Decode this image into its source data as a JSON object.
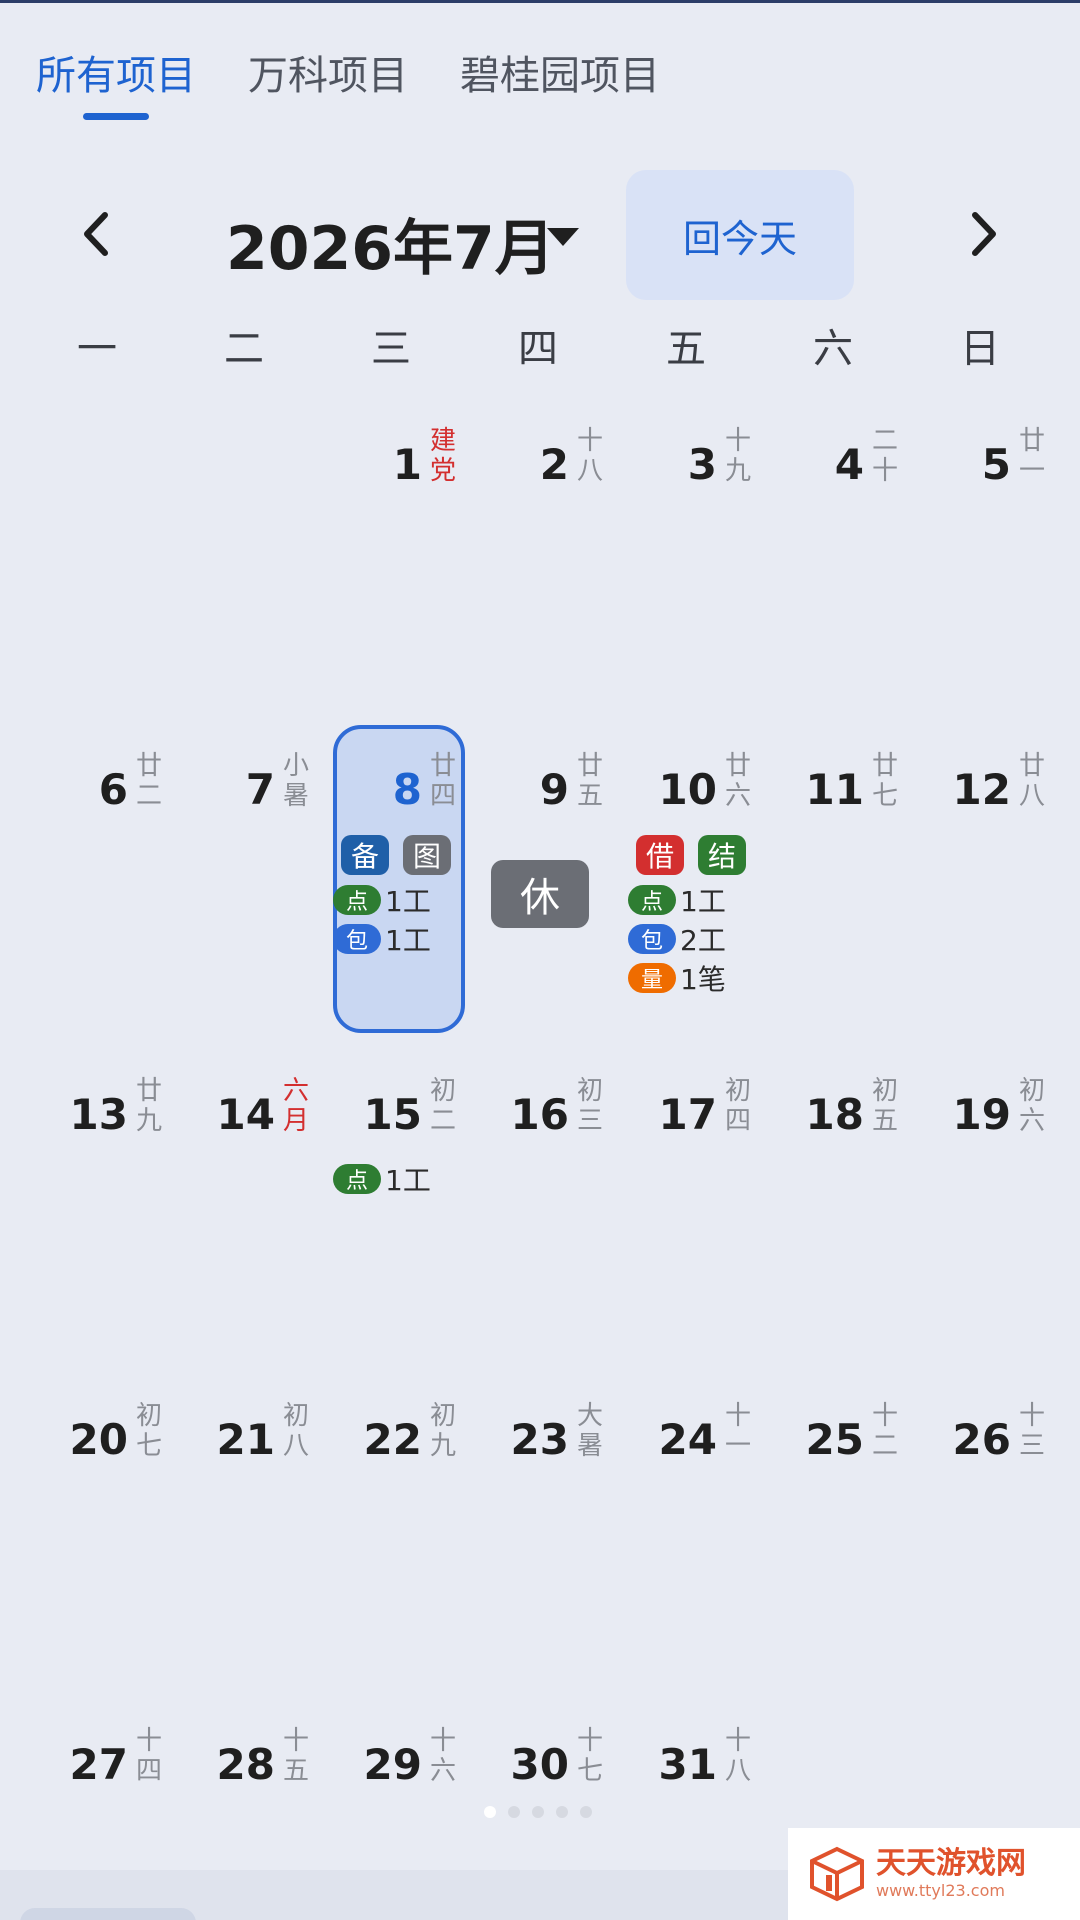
{
  "tabs": [
    {
      "label": "所有项目",
      "active": true
    },
    {
      "label": "万科项目",
      "active": false
    },
    {
      "label": "碧桂园项目",
      "active": false
    }
  ],
  "header": {
    "month_title": "2026年7月",
    "today_button": "回今天"
  },
  "weekdays": [
    "一",
    "二",
    "三",
    "四",
    "五",
    "六",
    "日"
  ],
  "colors": {
    "accent": "#1e63d0",
    "green": "#2e7d32",
    "blue": "#2f6bd6",
    "red": "#d32f2f",
    "orange": "#ef6c00",
    "gray": "#6b6e75",
    "navy": "#1f5fa8"
  },
  "days": [
    {
      "day": "1",
      "lunar": "建党",
      "lunar_red": true
    },
    {
      "day": "2",
      "lunar": "十八"
    },
    {
      "day": "3",
      "lunar": "十九"
    },
    {
      "day": "4",
      "lunar": "二十"
    },
    {
      "day": "5",
      "lunar": "廿一"
    },
    {
      "day": "6",
      "lunar": "廿二"
    },
    {
      "day": "7",
      "lunar": "小暑"
    },
    {
      "day": "8",
      "lunar": "廿四",
      "selected": true,
      "chips": [
        {
          "label": "备",
          "color": "navy"
        },
        {
          "label": "图",
          "color": "gray"
        }
      ],
      "items": [
        {
          "tag": "点",
          "color": "green",
          "text": "1工"
        },
        {
          "tag": "包",
          "color": "blue",
          "text": "1工"
        }
      ]
    },
    {
      "day": "9",
      "lunar": "廿五",
      "rest": "休"
    },
    {
      "day": "10",
      "lunar": "廿六",
      "chips": [
        {
          "label": "借",
          "color": "red"
        },
        {
          "label": "结",
          "color": "green"
        }
      ],
      "items": [
        {
          "tag": "点",
          "color": "green",
          "text": "1工"
        },
        {
          "tag": "包",
          "color": "blue",
          "text": "2工"
        },
        {
          "tag": "量",
          "color": "orange",
          "text": "1笔"
        }
      ]
    },
    {
      "day": "11",
      "lunar": "廿七"
    },
    {
      "day": "12",
      "lunar": "廿八"
    },
    {
      "day": "13",
      "lunar": "廿九"
    },
    {
      "day": "14",
      "lunar": "六月",
      "lunar_red": true
    },
    {
      "day": "15",
      "lunar": "初二",
      "items": [
        {
          "tag": "点",
          "color": "green",
          "text": "1工"
        }
      ]
    },
    {
      "day": "16",
      "lunar": "初三"
    },
    {
      "day": "17",
      "lunar": "初四"
    },
    {
      "day": "18",
      "lunar": "初五"
    },
    {
      "day": "19",
      "lunar": "初六"
    },
    {
      "day": "20",
      "lunar": "初七"
    },
    {
      "day": "21",
      "lunar": "初八"
    },
    {
      "day": "22",
      "lunar": "初九"
    },
    {
      "day": "23",
      "lunar": "大暑"
    },
    {
      "day": "24",
      "lunar": "十一"
    },
    {
      "day": "25",
      "lunar": "十二"
    },
    {
      "day": "26",
      "lunar": "十三"
    },
    {
      "day": "27",
      "lunar": "十四"
    },
    {
      "day": "28",
      "lunar": "十五"
    },
    {
      "day": "29",
      "lunar": "十六"
    },
    {
      "day": "30",
      "lunar": "十七"
    },
    {
      "day": "31",
      "lunar": "十八"
    }
  ],
  "first_weekday_index": 2,
  "page_dots": {
    "count": 5,
    "active": 0
  },
  "watermark": {
    "title": "天天游戏网",
    "url": "www.ttyl23.com"
  }
}
